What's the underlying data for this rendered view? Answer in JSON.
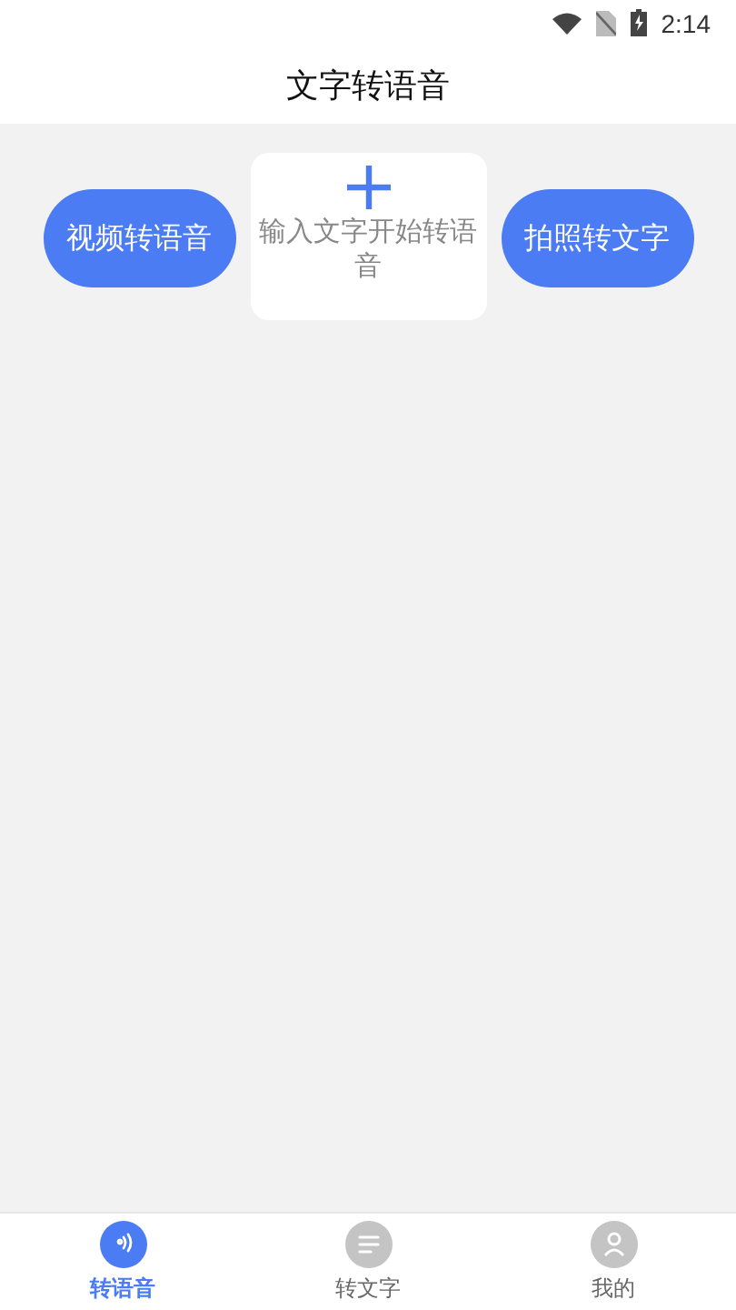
{
  "status_bar": {
    "time": "2:14"
  },
  "header": {
    "title": "文字转语音"
  },
  "actions": {
    "left_button": "视频转语音",
    "input_card": {
      "placeholder": "输入文字开始转语音"
    },
    "right_button": "拍照转文字"
  },
  "bottom_nav": [
    {
      "kind": "voice",
      "label": "转语音",
      "selected": true
    },
    {
      "kind": "text",
      "label": "转文字",
      "selected": false
    },
    {
      "kind": "profile",
      "label": "我的",
      "selected": false
    }
  ]
}
